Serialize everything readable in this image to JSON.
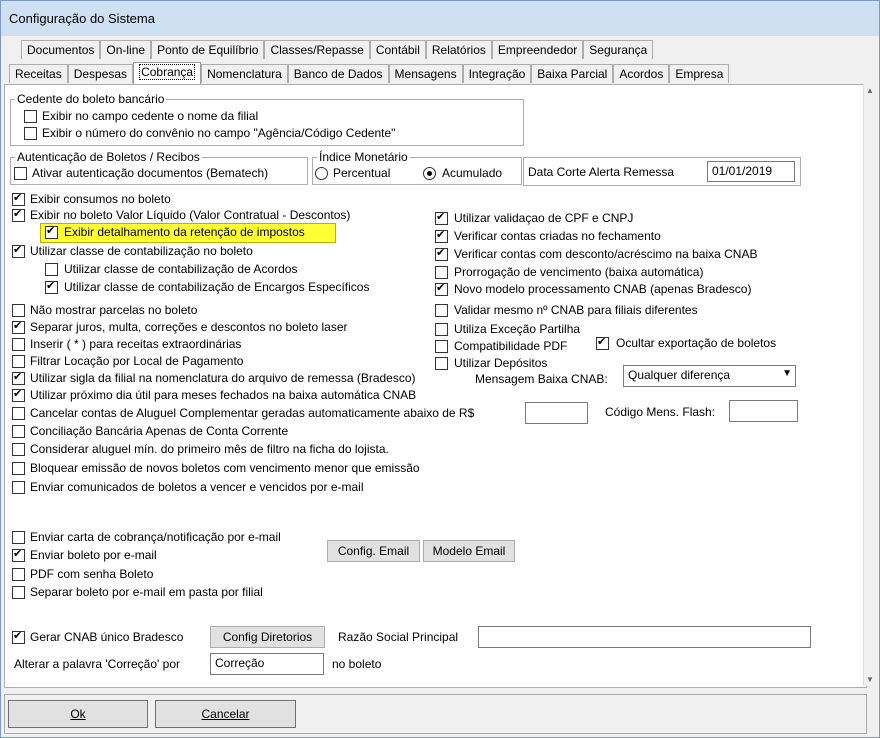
{
  "window": {
    "title": "Configuração do Sistema"
  },
  "tabs_row1": [
    "Documentos",
    "On-line",
    "Ponto de Equilíbrio",
    "Classes/Repasse",
    "Contábil",
    "Relatórios",
    "Empreendedor",
    "Segurança"
  ],
  "tabs_row2": [
    "Receitas",
    "Despesas",
    "Cobrança",
    "Nomenclatura",
    "Banco de Dados",
    "Mensagens",
    "Integração",
    "Baixa Parcial",
    "Acordos",
    "Empresa"
  ],
  "active_tab": "Cobrança",
  "cedente_group": {
    "title": "Cedente do boleto bancário",
    "items": [
      {
        "label": "Exibir no campo cedente o nome da filial",
        "checked": false
      },
      {
        "label": "Exibir o número do convênio no campo \"Agência/Código Cedente\"",
        "checked": false
      }
    ]
  },
  "autenticacao_group": {
    "title": "Autenticação de Boletos / Recibos",
    "item": {
      "label": "Ativar autenticação documentos (Bematech)",
      "checked": false
    }
  },
  "indice_group": {
    "title": "Índice Monetário",
    "options": [
      {
        "label": "Percentual",
        "selected": false
      },
      {
        "label": "Acumulado",
        "selected": true
      }
    ]
  },
  "data_corte": {
    "label": "Data Corte Alerta Remessa",
    "value": "01/01/2019"
  },
  "left_options": [
    {
      "label": "Exibir consumos no boleto",
      "checked": true
    },
    {
      "label": "Exibir no boleto Valor Líquido (Valor Contratual - Descontos)",
      "checked": true
    },
    {
      "label": "Exibir detalhamento da retenção de impostos",
      "checked": true
    },
    {
      "label": "Utilizar classe de contabilização no boleto",
      "checked": true
    },
    {
      "label": "Utilizar classe de contabilização de Acordos",
      "checked": false
    },
    {
      "label": "Utilizar classe de contabilização de Encargos Específicos",
      "checked": true
    },
    {
      "label": "Não mostrar parcelas no boleto",
      "checked": false
    },
    {
      "label": "Separar juros, multa, correções e descontos no boleto laser",
      "checked": true
    },
    {
      "label": "Inserir ( * ) para receitas extraordinárias",
      "checked": false
    },
    {
      "label": "Filtrar Locação por Local de Pagamento",
      "checked": false
    },
    {
      "label": "Utilizar sigla da filial na nomenclatura do arquivo de remessa (Bradesco)",
      "checked": true
    },
    {
      "label": "Utilizar próximo dia útil para meses fechados na baixa automática CNAB",
      "checked": true
    },
    {
      "label": "Cancelar contas de Aluguel Complementar geradas automaticamente abaixo de R$",
      "checked": false
    },
    {
      "label": "Conciliação Bancária Apenas de Conta Corrente",
      "checked": false
    },
    {
      "label": "Considerar aluguel mín. do primeiro mês de filtro na ficha do lojista.",
      "checked": false
    },
    {
      "label": "Bloquear emissão de novos boletos com vencimento menor que emissão",
      "checked": false
    },
    {
      "label": "Enviar comunicados de boletos a vencer e vencidos por e-mail",
      "checked": false
    }
  ],
  "right_options": [
    {
      "label": "Utilizar validaçao de CPF e CNPJ",
      "checked": true
    },
    {
      "label": "Verificar contas criadas no fechamento",
      "checked": true
    },
    {
      "label": "Verificar contas com desconto/acréscimo na baixa CNAB",
      "checked": true
    },
    {
      "label": "Prorrogação de vencimento (baixa automática)",
      "checked": false
    },
    {
      "label": "Novo modelo processamento CNAB (apenas Bradesco)",
      "checked": true
    },
    {
      "label": "Validar mesmo nº CNAB para filiais diferentes",
      "checked": false
    },
    {
      "label": "Utiliza Exceção Partilha",
      "checked": false
    },
    {
      "label": "Compatibilidade PDF",
      "checked": false
    },
    {
      "label": "Utilizar Depósitos",
      "checked": false
    }
  ],
  "ocultar_exportacao": {
    "label": "Ocultar exportação de boletos",
    "checked": true
  },
  "mensagem_baixa": {
    "label": "Mensagem Baixa CNAB:",
    "value": "Qualquer diferença"
  },
  "codigo_flash": {
    "label": "Código Mens. Flash:",
    "value": ""
  },
  "cancelar_valor": "",
  "email_options": [
    {
      "label": "Enviar carta de cobrança/notificação por e-mail",
      "checked": false
    },
    {
      "label": "Enviar boleto por e-mail",
      "checked": true
    },
    {
      "label": "PDF com senha Boleto",
      "checked": false
    },
    {
      "label": "Separar boleto por e-mail em pasta por filial",
      "checked": false
    }
  ],
  "buttons": {
    "config_email": "Config. Email",
    "modelo_email": "Modelo Email",
    "config_diretorios": "Config Diretorios",
    "ok": "Ok",
    "cancelar": "Cancelar"
  },
  "cnab_unico": {
    "label": "Gerar CNAB único Bradesco",
    "checked": true
  },
  "razao_social": {
    "label": "Razão Social Principal",
    "value": ""
  },
  "correcao": {
    "label": "Alterar a palavra 'Correção' por",
    "value": "Correção",
    "suffix": "no boleto"
  }
}
